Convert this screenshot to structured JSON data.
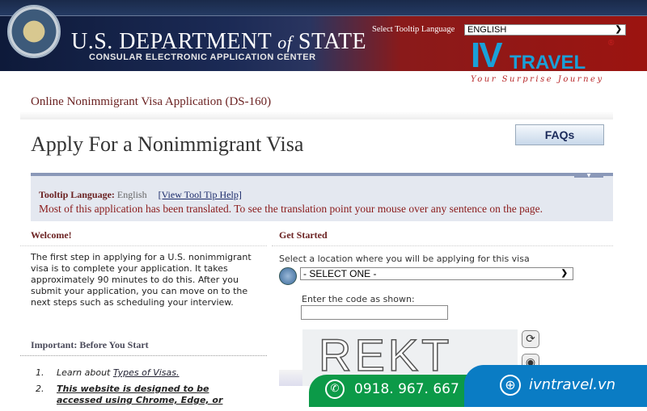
{
  "header": {
    "title_main": "U.S. DEPARTMENT ",
    "title_of": "of",
    "title_state": " STATE",
    "subtitle": "CONSULAR ELECTRONIC APPLICATION CENTER",
    "tooltip_label": "Select Tooltip Language",
    "tooltip_value": "ENGLISH"
  },
  "watermark": {
    "logo": "IVTRAVEL",
    "slogan": "Your Surprise Journey"
  },
  "page": {
    "subtitle": "Online Nonimmigrant Visa Application (DS-160)",
    "title": "Apply For a Nonimmigrant Visa",
    "faq_label": "FAQs"
  },
  "tooltip": {
    "label": "Tooltip Language:",
    "language": "English",
    "help_link": "[View Tool Tip Help]",
    "message": "Most of this application has been translated. To see the translation point your mouse over any sentence on the page."
  },
  "welcome": {
    "heading": "Welcome!",
    "text": "The first step in applying for a U.S. nonimmigrant visa is to complete your application. It takes approximately 90 minutes to do this. After you submit your application, you can move on to the next steps such as scheduling your interview.",
    "important_heading": "Important: Before You Start",
    "items": [
      {
        "num": "1.",
        "prefix": "Learn about ",
        "link": "Types of Visas."
      },
      {
        "num": "2.",
        "bold": "This website is designed to be accessed using Chrome, Edge, or"
      }
    ]
  },
  "get_started": {
    "heading": "Get Started",
    "location_label": "Select a location where you will be applying for this visa",
    "location_value": "- SELECT ONE -",
    "code_label": "Enter the code as shown:",
    "code_value": "",
    "captcha": "REKT"
  },
  "contact": {
    "phone": "0918. 967. 667",
    "website": "ivntravel.vn"
  },
  "colors": {
    "header_red": "#9c1410",
    "header_navy": "#1b2a55",
    "heading_maroon": "#6b2222",
    "green": "#0c9a48",
    "blue": "#0a7cc4"
  }
}
